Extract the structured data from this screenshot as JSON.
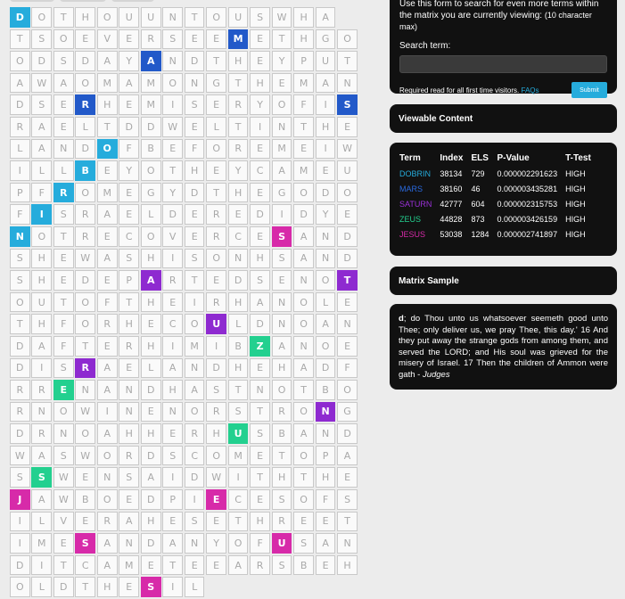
{
  "grid": {
    "rows": [
      "DOTHOUUNTOUSWHA",
      "TSOEVERSEEMETHGO",
      "ODSDAYANDTHEYPUT",
      "AWAOMAMONGTHEMAN",
      "DSERHEMISERYOFIS",
      "RAELTDDWELTINTHE",
      "LANDOFBEFOREMEIW",
      "ILLBEYOTHEYCAMEU",
      "PFROMEGYDTHEGODO",
      "FISRAELDEREDIDYE",
      "NOTRECOVERCESAND",
      "SHEWASHISONHSAND",
      "SHEDEPARTEDSENOT",
      "OUTOFTHEIRHANOLE",
      "THFORHECOULDNOAN",
      "DAFTERHIMIBZANOE",
      "DISRAELANDHEHADF",
      "RRENANDHASTNOTBO",
      "RNOWINENORSTRONG",
      "DRNOAHHERHUSBAND",
      "WASWORDSCOMETOPA",
      "SSWENSAIDWITHTHE",
      "JAWBOEDPIECESOFS",
      "ILVERAHESETHREET",
      "IMESANDANYOFUSAN",
      "DITCAMETEEARSBEH",
      "OLDTHESIL"
    ],
    "highlights": [
      {
        "r": 0,
        "c": 0,
        "color": "cyan"
      },
      {
        "r": 1,
        "c": 10,
        "color": "blue"
      },
      {
        "r": 2,
        "c": 6,
        "color": "blue"
      },
      {
        "r": 4,
        "c": 3,
        "color": "blue"
      },
      {
        "r": 4,
        "c": 15,
        "color": "blue"
      },
      {
        "r": 6,
        "c": 4,
        "color": "cyan"
      },
      {
        "r": 7,
        "c": 3,
        "color": "cyan"
      },
      {
        "r": 8,
        "c": 2,
        "color": "cyan"
      },
      {
        "r": 9,
        "c": 1,
        "color": "cyan"
      },
      {
        "r": 10,
        "c": 0,
        "color": "cyan"
      },
      {
        "r": 10,
        "c": 12,
        "color": "magenta"
      },
      {
        "r": 12,
        "c": 6,
        "color": "purple"
      },
      {
        "r": 12,
        "c": 15,
        "color": "purple"
      },
      {
        "r": 14,
        "c": 9,
        "color": "purple"
      },
      {
        "r": 15,
        "c": 11,
        "color": "green"
      },
      {
        "r": 16,
        "c": 3,
        "color": "purple"
      },
      {
        "r": 17,
        "c": 2,
        "color": "green"
      },
      {
        "r": 18,
        "c": 14,
        "color": "purple"
      },
      {
        "r": 19,
        "c": 10,
        "color": "green"
      },
      {
        "r": 21,
        "c": 1,
        "color": "green"
      },
      {
        "r": 22,
        "c": 0,
        "color": "magenta"
      },
      {
        "r": 22,
        "c": 9,
        "color": "magenta"
      },
      {
        "r": 24,
        "c": 3,
        "color": "magenta"
      },
      {
        "r": 24,
        "c": 12,
        "color": "magenta"
      },
      {
        "r": 26,
        "c": 6,
        "color": "magenta"
      }
    ]
  },
  "search": {
    "intro": "Use this form to search for even more terms within the matrix you are currently viewing:",
    "max_note": "(10 character max)",
    "label": "Search term:",
    "input_value": "",
    "footer_text": "Required read for all first time visitors.",
    "faq_link": "FAQs",
    "submit_label": "Submit"
  },
  "viewable": {
    "title": "Viewable Content"
  },
  "terms": {
    "headers": [
      "Term",
      "Index",
      "ELS",
      "P-Value",
      "T-Test"
    ],
    "rows": [
      {
        "term": "DOBRIN",
        "index": "38134",
        "els": "729",
        "pvalue": "0.000002291623",
        "ttest": "HIGH",
        "color": "#26acdc"
      },
      {
        "term": "MARS",
        "index": "38160",
        "els": "46",
        "pvalue": "0.000003435281",
        "ttest": "HIGH",
        "color": "#2a6ae0"
      },
      {
        "term": "SATURN",
        "index": "42777",
        "els": "604",
        "pvalue": "0.000002315753",
        "ttest": "HIGH",
        "color": "#9b30d9"
      },
      {
        "term": "ZEUS",
        "index": "44828",
        "els": "873",
        "pvalue": "0.000003426159",
        "ttest": "HIGH",
        "color": "#23d08f"
      },
      {
        "term": "JESUS",
        "index": "53038",
        "els": "1284",
        "pvalue": "0.000002741897",
        "ttest": "HIGH",
        "color": "#d72aa9"
      }
    ]
  },
  "matrix_sample": {
    "title": "Matrix Sample",
    "first": "d",
    "text": "; do Thou unto us whatsoever seemeth good unto Thee; only deliver us, we pray Thee, this day.' 16 And they put away the strange gods from among them, and served the LORD; and His soul was grieved for the misery of Israel. 17 Then the children of Ammon were gath - ",
    "book": "Judges"
  }
}
